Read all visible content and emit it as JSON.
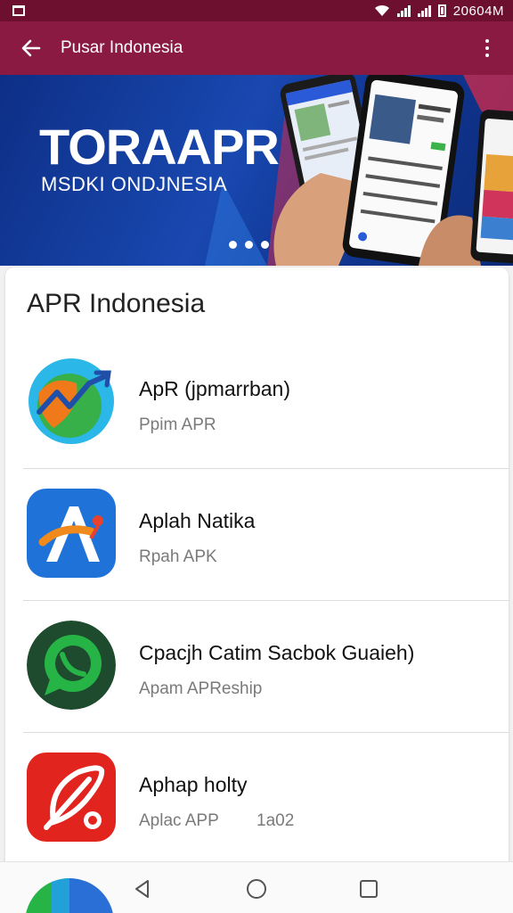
{
  "status_bar": {
    "time": "20604M"
  },
  "app_bar": {
    "title": "Pusar Indonesia"
  },
  "banner": {
    "headline": "TORAAPR",
    "subline": "MSDKI ONDJNESIA",
    "page_count": 3
  },
  "section": {
    "title": "APR Indonesia"
  },
  "apps": [
    {
      "name": "ApR (jpmarrban)",
      "subtitle": "Ppim APR",
      "icon": "chart-globe-icon"
    },
    {
      "name": "Aplah Natika",
      "subtitle": "Rpah APK",
      "icon": "letter-a-icon"
    },
    {
      "name": "Cpacjh Catim Sacbok Guaieh)",
      "subtitle": "Apam APReship",
      "icon": "chat-bubble-icon"
    },
    {
      "name": "Aphap holty",
      "subtitle": "Aplac APP",
      "extra": "1a02",
      "icon": "compass-icon"
    }
  ],
  "colors": {
    "status": "#6d0f2f",
    "app_bar": "#8a1a42",
    "banner": "#1948b0"
  }
}
